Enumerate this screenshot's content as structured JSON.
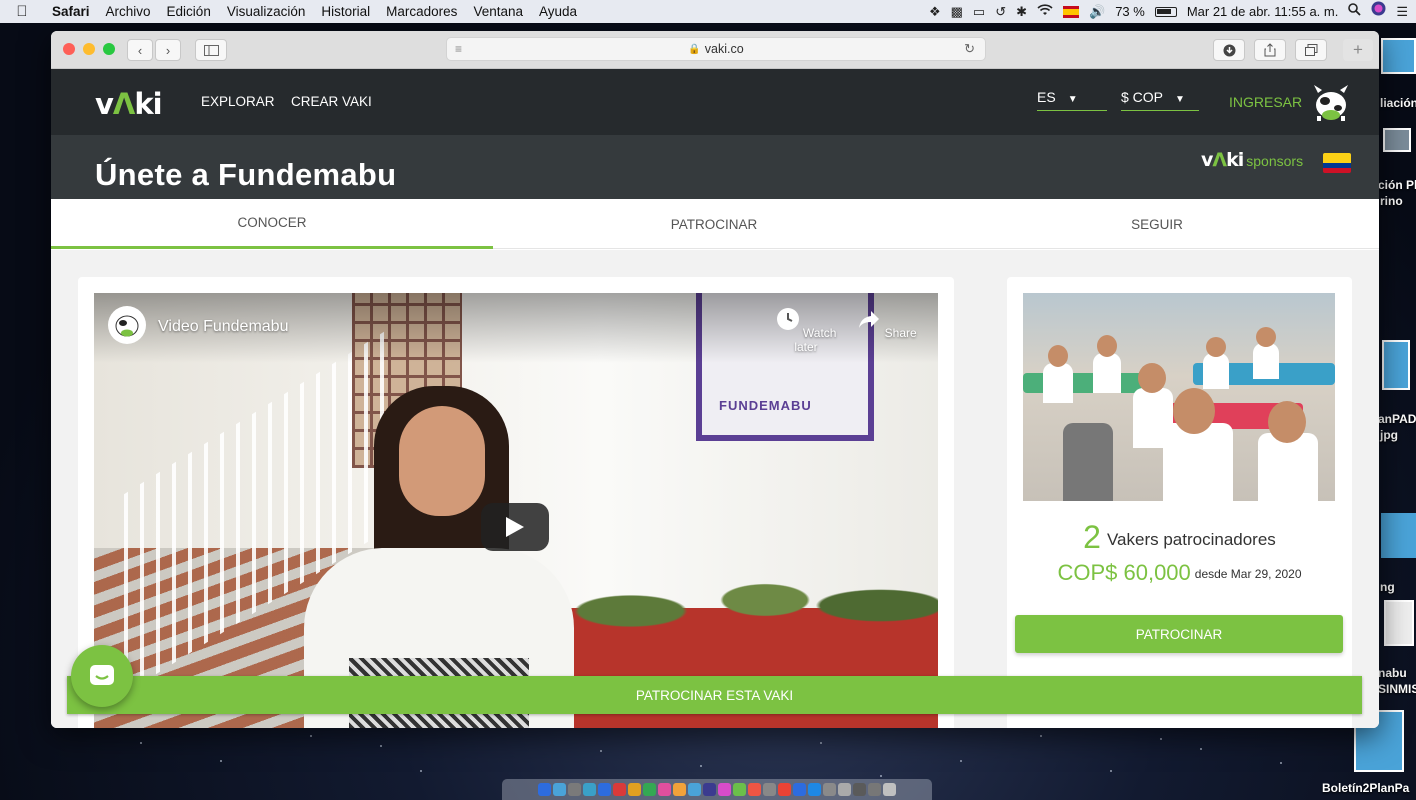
{
  "menubar": {
    "app_name": "Safari",
    "items": [
      "Archivo",
      "Edición",
      "Visualización",
      "Historial",
      "Marcadores",
      "Ventana",
      "Ayuda"
    ],
    "battery": "73 %",
    "datetime": "Mar 21 de abr.  11:55 a. m.",
    "status_icons": [
      "dropbox-icon",
      "camera-icon",
      "airplay-icon",
      "time-machine-icon",
      "bluetooth-icon",
      "wifi-icon",
      "flag-icon",
      "volume-icon",
      "battery-icon"
    ]
  },
  "browser": {
    "url": "vaki.co"
  },
  "vaki": {
    "logo": {
      "part1": "v",
      "part2": "Λ",
      "part3": "ki"
    },
    "nav": {
      "explorar": "EXPLORAR",
      "crear": "CREAR VAKI"
    },
    "language": "ES",
    "currency": "$ COP",
    "login": "INGRESAR",
    "page_title": "Únete a Fundemabu",
    "sponsors_word": "sponsors",
    "tabs": [
      "CONOCER",
      "PATROCINAR",
      "SEGUIR"
    ],
    "video": {
      "title": "Video Fundemabu",
      "watch_later": "Watch later",
      "share": "Share",
      "mural_text": "FUNDEMABU"
    },
    "sidebar": {
      "count": "2",
      "count_label": "Vakers patrocinadores",
      "amount": "COP$ 60,000",
      "since": "desde Mar 29, 2020",
      "button": "PATROCINAR"
    },
    "bottom_bar": "PATROCINAR ESTA VAKI"
  },
  "desktop": {
    "labels": [
      "liación",
      "ción Pl",
      "rino",
      "anPAD",
      "jpg",
      "ng",
      "nabu",
      "SINMIS",
      "Boletín2PlanPa"
    ]
  },
  "colors": {
    "brand_green": "#7cc242",
    "nav_dark": "#262a2d",
    "header_dark": "#353a3d"
  }
}
